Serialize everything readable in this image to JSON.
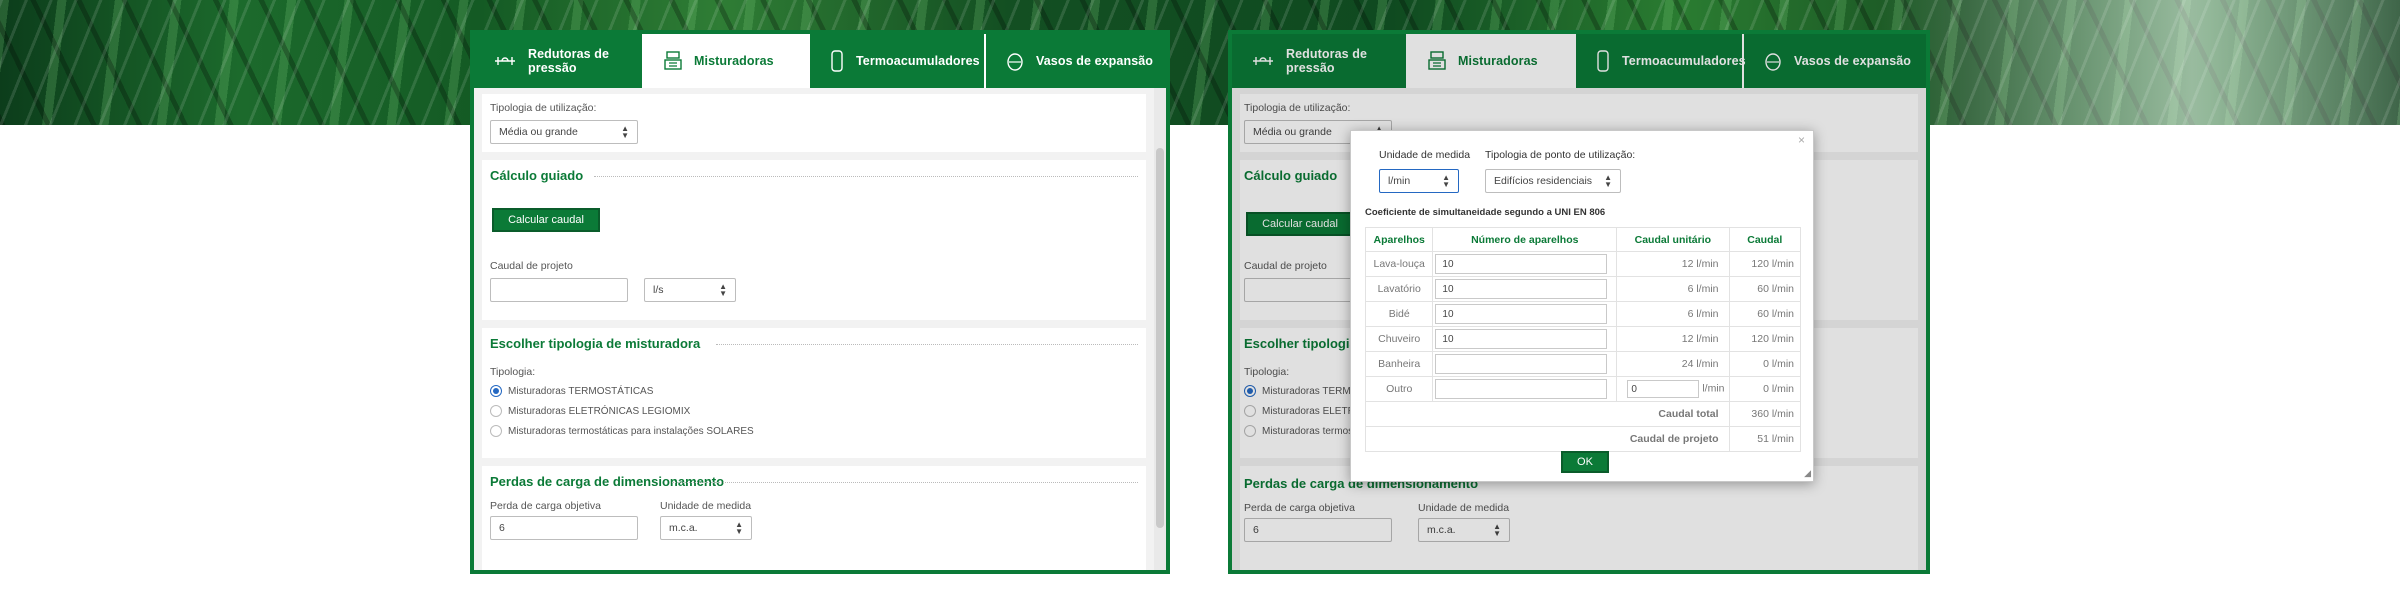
{
  "tabs": [
    {
      "label": "Redutoras de pressão",
      "icon": "pressure-reducer-icon"
    },
    {
      "label": "Misturadoras",
      "icon": "mixer-valve-icon"
    },
    {
      "label": "Termoacumuladores",
      "icon": "water-heater-icon"
    },
    {
      "label": "Vasos de expansão",
      "icon": "expansion-vessel-icon"
    }
  ],
  "form": {
    "tipologia_label": "Tipologia de utilização:",
    "tipologia_value": "Média ou grande",
    "calculo_title": "Cálculo guiado",
    "calcular_button": "Calcular caudal",
    "caudal_label": "Caudal de projeto",
    "caudal_value": "",
    "caudal_unit": "l/s",
    "escolher_title": "Escolher tipologia de misturadora",
    "tipologia2_label": "Tipologia:",
    "options": [
      "Misturadoras TERMOSTÁTICAS",
      "Misturadoras ELETRÓNICAS LEGIOMIX",
      "Misturadoras termostáticas para instalações SOLARES"
    ],
    "perdas_title": "Perdas de carga de dimensionamento",
    "perda_label": "Perda de carga objetiva",
    "perda_value": "6",
    "unidade_label": "Unidade de medida",
    "unidade_value": "m.c.a."
  },
  "modal": {
    "close": "×",
    "unidade_label": "Unidade de medida",
    "unidade_value": "l/min",
    "ponto_label": "Tipologia de ponto de utilização:",
    "ponto_value": "Edifícios residenciais",
    "coef_text": "Coeficiente de simultaneidade segundo a UNI EN 806",
    "headers": [
      "Aparelhos",
      "Número de aparelhos",
      "Caudal unitário",
      "Caudal"
    ],
    "rows": [
      {
        "name": "Lava-louça",
        "count": "10",
        "unit": "12 l/min",
        "flow": "120 l/min"
      },
      {
        "name": "Lavatório",
        "count": "10",
        "unit": "6 l/min",
        "flow": "60 l/min"
      },
      {
        "name": "Bidé",
        "count": "10",
        "unit": "6 l/min",
        "flow": "60 l/min"
      },
      {
        "name": "Chuveiro",
        "count": "10",
        "unit": "12 l/min",
        "flow": "120 l/min"
      },
      {
        "name": "Banheira",
        "count": "",
        "unit": "24 l/min",
        "flow": "0 l/min"
      }
    ],
    "outro": {
      "name": "Outro",
      "count": "",
      "unit_value": "0",
      "unit_suffix": "l/min",
      "flow": "0 l/min"
    },
    "total_label": "Caudal total",
    "total_value": "360 l/min",
    "projeto_label": "Caudal de projeto",
    "projeto_value": "51 l/min",
    "ok": "OK"
  },
  "colors": {
    "brand_green": "#0b7a37",
    "radio_blue": "#2468c2"
  }
}
